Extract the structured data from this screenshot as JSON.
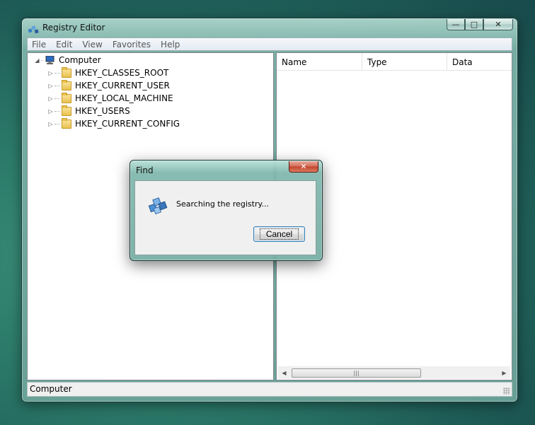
{
  "window": {
    "title": "Registry Editor",
    "caption": {
      "minimize": "—",
      "maximize": "□",
      "close": "✕"
    }
  },
  "menu": [
    "File",
    "Edit",
    "View",
    "Favorites",
    "Help"
  ],
  "tree": {
    "root": "Computer",
    "keys": [
      "HKEY_CLASSES_ROOT",
      "HKEY_CURRENT_USER",
      "HKEY_LOCAL_MACHINE",
      "HKEY_USERS",
      "HKEY_CURRENT_CONFIG"
    ]
  },
  "list": {
    "columns": [
      "Name",
      "Type",
      "Data"
    ],
    "scroll": {
      "left": "◀",
      "right": "▶",
      "grip": "|||"
    }
  },
  "status": "Computer",
  "dialog": {
    "title": "Find",
    "message": "Searching the registry...",
    "cancel_label": "Cancel",
    "close": "✕"
  }
}
